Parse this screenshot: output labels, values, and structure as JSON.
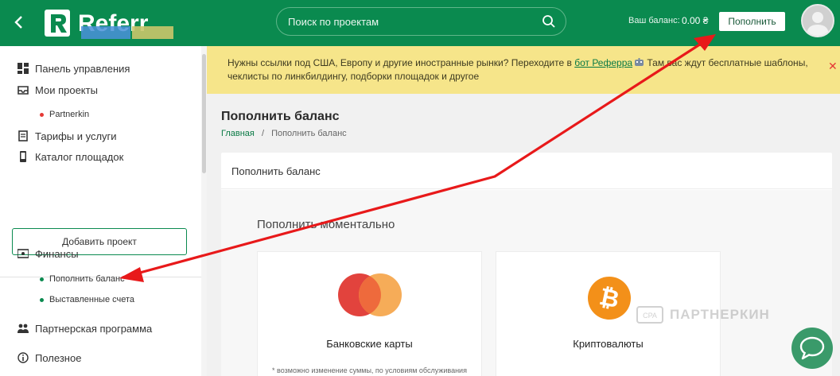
{
  "header": {
    "logo_text": "Referr",
    "search_placeholder": "Поиск по проектам",
    "balance_label": "Ваш баланс:",
    "balance_value": "0.00 ₴",
    "topup_button": "Пополнить"
  },
  "sidebar": {
    "items": [
      {
        "label": "Панель управления",
        "icon": "dashboard-icon"
      },
      {
        "label": "Мои проекты",
        "icon": "inbox-icon"
      },
      {
        "label": "Тарифы и услуги",
        "icon": "document-icon"
      },
      {
        "label": "Каталог площадок",
        "icon": "phone-icon"
      }
    ],
    "projects": [
      {
        "label": "Partnerkin",
        "dot_color": "#e53935"
      }
    ],
    "add_project_button": "Добавить проект",
    "finance": {
      "label": "Финансы",
      "icon": "money-icon"
    },
    "finance_sub": [
      {
        "label": "Пополнить баланс",
        "dot_color": "#0a8a4f"
      },
      {
        "label": "Выставленные счета",
        "dot_color": "#0a8a4f"
      }
    ],
    "partner_program": {
      "label": "Партнерская программа",
      "icon": "partner-icon"
    },
    "useful": {
      "label": "Полезное",
      "icon": "info-icon"
    }
  },
  "notice": {
    "text_before": "Нужны ссылки под США, Европу и другие иностранные рынки? Переходите в ",
    "link_text": "бот Реферра",
    "text_after": " Там вас ждут бесплатные шаблоны, чеклисты по линкбилдингу, подборки площадок и другое"
  },
  "page": {
    "title": "Пополнить баланс",
    "breadcrumb_home": "Главная",
    "breadcrumb_sep": "/",
    "breadcrumb_current": "Пополнить баланс"
  },
  "card": {
    "title": "Пополнить баланс",
    "section_title": "Пополнить моментально",
    "options": [
      {
        "label": "Банковские карты",
        "icon": "mastercard-icon",
        "note": "* возможно изменение суммы, по условиям обслуживания"
      },
      {
        "label": "Криптовалюты",
        "icon": "bitcoin-icon",
        "note": ""
      }
    ]
  },
  "watermark": {
    "text": "ПАРТНЕРКИН"
  },
  "colors": {
    "brand_green": "#0a8a4f",
    "notice_yellow": "#f6e58a",
    "annotation_red": "#e8191a",
    "mastercard_red": "#e2433d",
    "mastercard_orange": "#f5a54a",
    "bitcoin_orange": "#f39019"
  }
}
